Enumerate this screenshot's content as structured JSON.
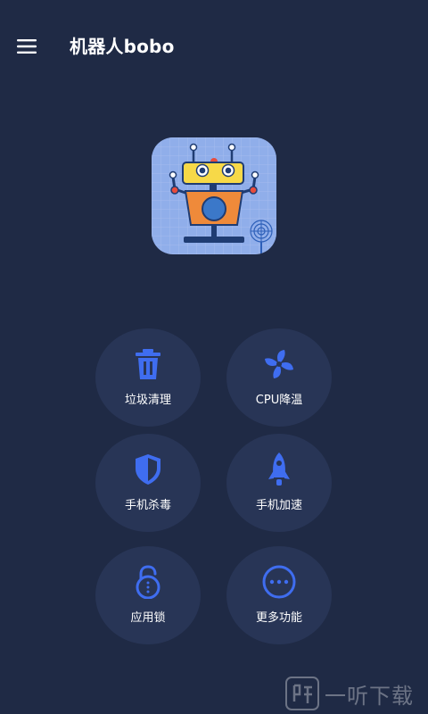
{
  "app": {
    "title": "机器人bobo"
  },
  "header": {
    "menu_icon": "hamburger-menu-icon"
  },
  "logo": {
    "icon": "robot-logo-icon"
  },
  "features": [
    {
      "label": "垃圾清理",
      "icon": "trash-icon"
    },
    {
      "label": "CPU降温",
      "icon": "fan-icon"
    },
    {
      "label": "手机杀毒",
      "icon": "shield-icon"
    },
    {
      "label": "手机加速",
      "icon": "rocket-icon"
    },
    {
      "label": "应用锁",
      "icon": "unlock-icon"
    },
    {
      "label": "更多功能",
      "icon": "more-dots-icon"
    }
  ],
  "watermark": {
    "text": "一听下载"
  },
  "colors": {
    "background": "#1f2a45",
    "button_bg": "#283556",
    "icon_accent": "#3f6df0"
  }
}
